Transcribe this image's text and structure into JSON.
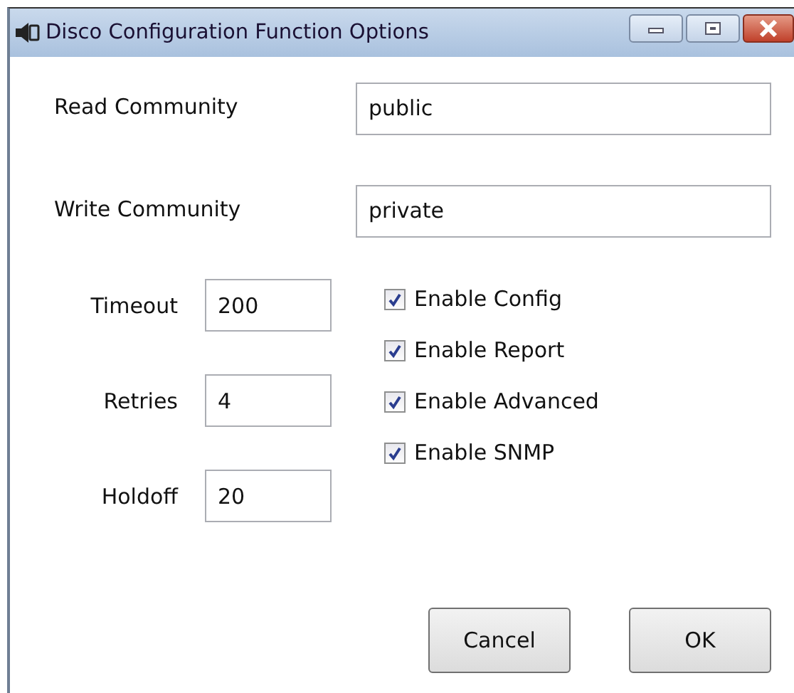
{
  "window": {
    "title": "Disco Configuration Function Options"
  },
  "community_fields": [
    {
      "label": "Read Community",
      "value": "public"
    },
    {
      "label": "Write Community",
      "value": "private"
    }
  ],
  "numeric_fields": [
    {
      "label": "Timeout",
      "value": "200"
    },
    {
      "label": "Retries",
      "value": "4"
    },
    {
      "label": "Holdoff",
      "value": "20"
    }
  ],
  "checkboxes": [
    {
      "label": "Enable Config",
      "checked": true
    },
    {
      "label": "Enable Report",
      "checked": true
    },
    {
      "label": "Enable Advanced",
      "checked": true
    },
    {
      "label": "Enable SNMP",
      "checked": true
    }
  ],
  "buttons": [
    "Cancel",
    "OK"
  ]
}
